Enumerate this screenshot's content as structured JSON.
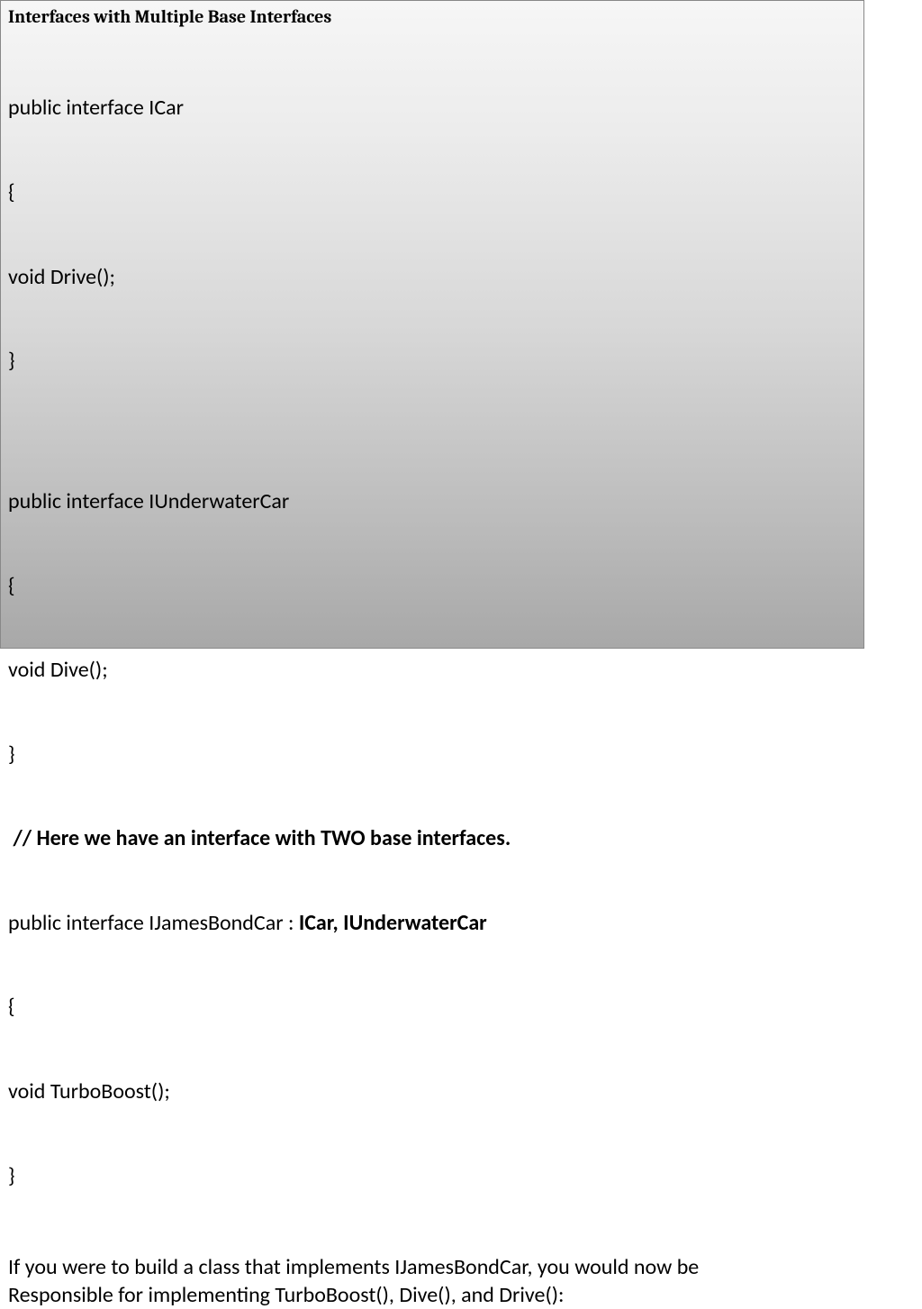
{
  "slide": {
    "title": "Interfaces with Multiple Base Interfaces",
    "code": {
      "icar_decl": "public interface ICar",
      "open_brace": "{",
      "icar_method": "void Drive();",
      "close_brace": "}",
      "blank": "",
      "iunder_decl": "public interface IUnderwaterCar",
      "iunder_method": "void Dive();",
      "comment": " // Here we have an interface with TWO base interfaces.",
      "ijames_decl_prefix": "public interface IJamesBondCar : ",
      "ijames_bases": "ICar, IUnderwaterCar",
      "ijames_method": "void TurboBoost();"
    },
    "note_line1": "If you were to build a class that implements IJamesBondCar, you would now be",
    "note_line2": "Responsible for implementing TurboBoost(), Dive(), and Drive():"
  }
}
